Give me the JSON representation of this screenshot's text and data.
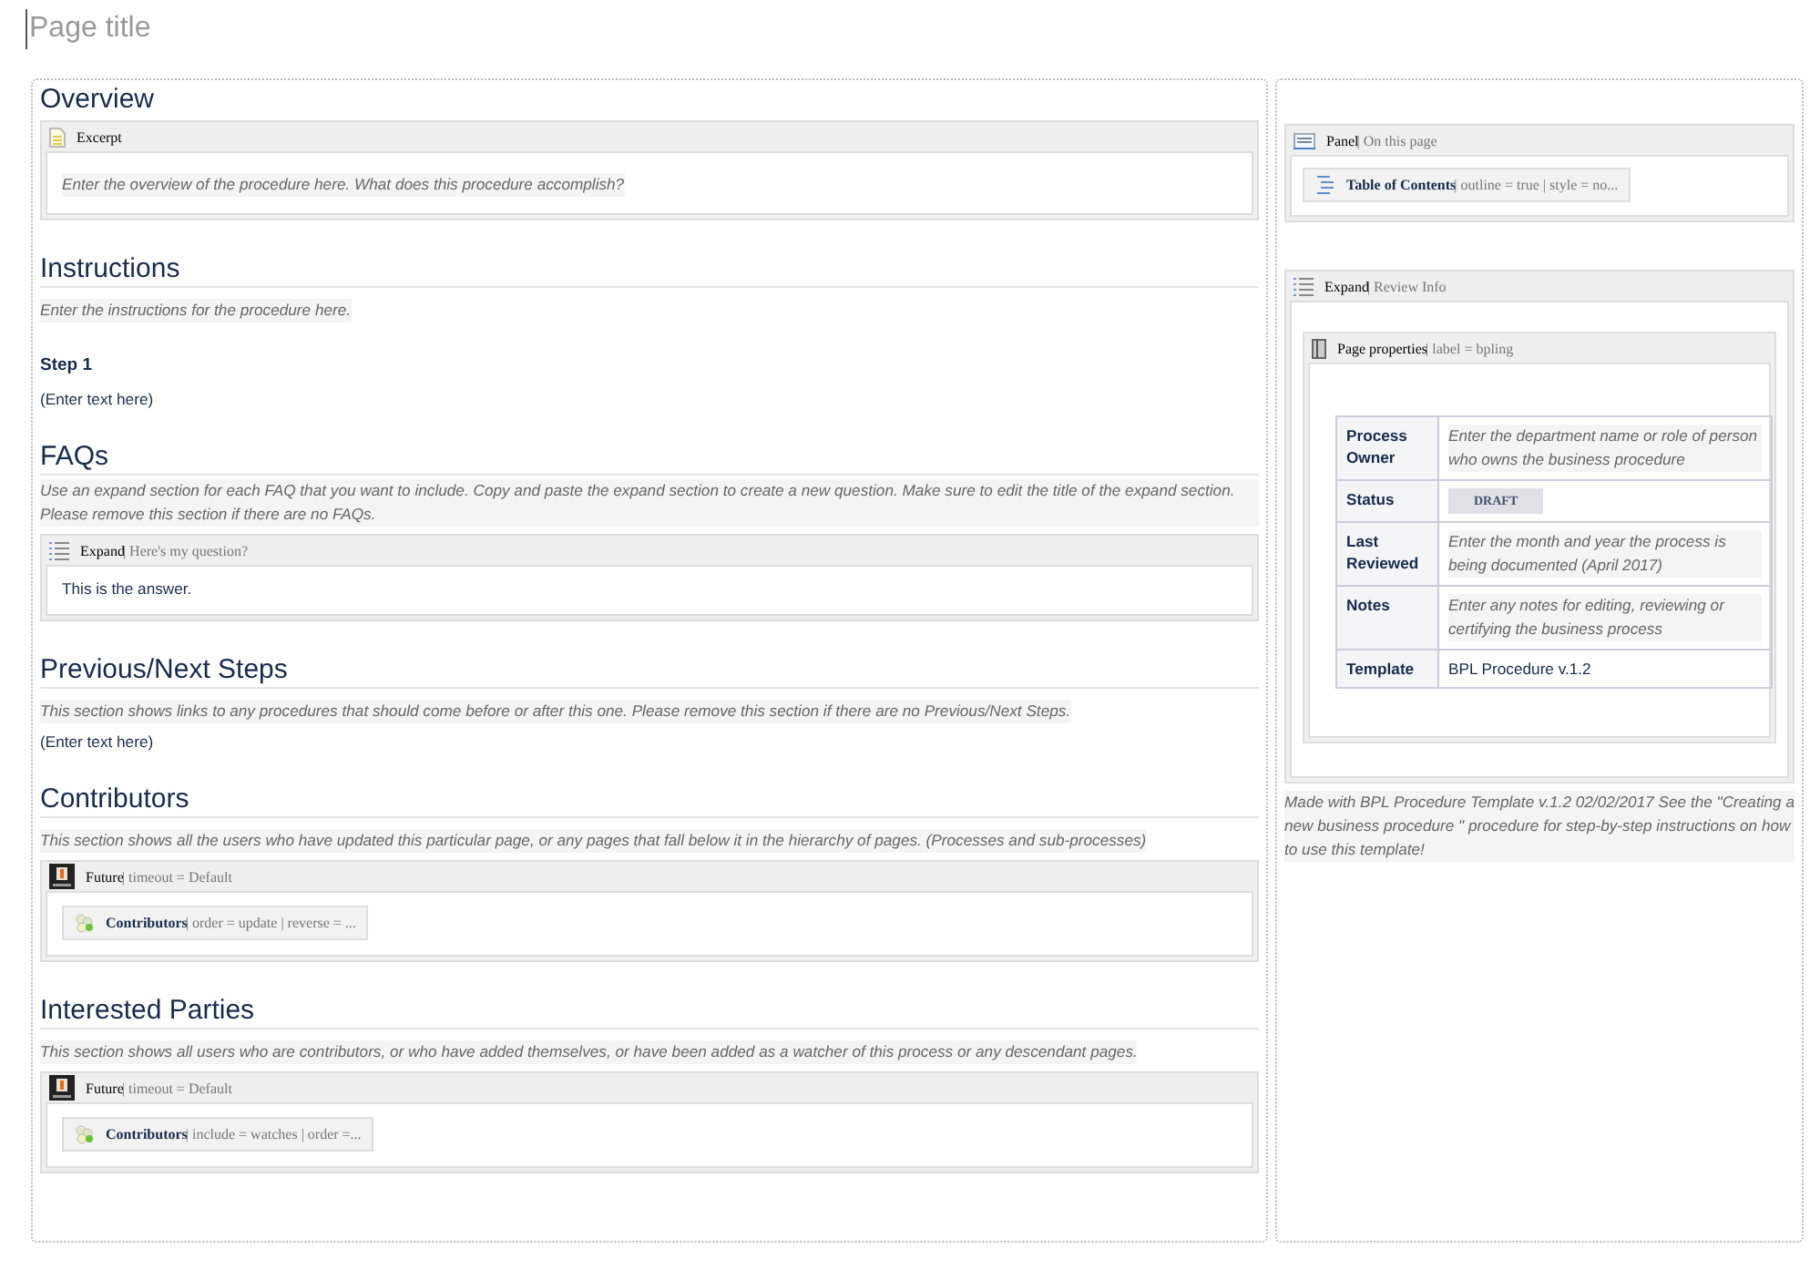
{
  "page_title": {
    "placeholder": "Page title"
  },
  "main": [
    {
      "kind": "heading",
      "text": "Overview"
    },
    {
      "kind": "excerpt",
      "name": "Excerpt",
      "body": [
        {
          "kind": "instruction",
          "text": "Enter the overview of the procedure here. What does this procedure accomplish?"
        }
      ]
    },
    {
      "kind": "heading",
      "text": "Instructions"
    },
    {
      "kind": "instruction",
      "text": "Enter the instructions for the procedure here."
    },
    {
      "kind": "subheading",
      "text": "Step 1"
    },
    {
      "kind": "paragraph",
      "text": "(Enter text here)"
    },
    {
      "kind": "heading",
      "text": "FAQs"
    },
    {
      "kind": "instruction",
      "text": "Use an expand section for each FAQ that you want to include. Copy and paste the expand section to create a new question. Make sure to edit the title of the expand section. Please remove this section if there are no FAQs."
    },
    {
      "kind": "expand",
      "name": "Expand",
      "params": "| Here's my question?",
      "body": [
        {
          "kind": "paragraph",
          "text": "This is the answer."
        }
      ]
    },
    {
      "kind": "heading",
      "text": "Previous/Next Steps"
    },
    {
      "kind": "instruction",
      "text": "This section shows links to any procedures that should come before or after this one. Please remove this section if there are no Previous/Next Steps."
    },
    {
      "kind": "paragraph",
      "text": "(Enter text here)"
    },
    {
      "kind": "heading",
      "text": "Contributors"
    },
    {
      "kind": "instruction",
      "text": "This section shows all the users who have updated this particular page, or any pages that fall below it in the hierarchy of pages. (Processes and sub-processes)"
    },
    {
      "kind": "future",
      "name": "Future",
      "params": "| timeout = Default",
      "body": [
        {
          "kind": "contributors",
          "name": "Contributors",
          "params": "| order = update | reverse = ..."
        }
      ]
    },
    {
      "kind": "heading",
      "text": "Interested Parties"
    },
    {
      "kind": "instruction",
      "text": "This section shows all users who are contributors, or who have added themselves, or have been added as a watcher of this process or any descendant pages."
    },
    {
      "kind": "future",
      "name": "Future",
      "params": "| timeout = Default",
      "body": [
        {
          "kind": "contributors",
          "name": "Contributors",
          "params": "| include = watches | order =..."
        }
      ]
    }
  ],
  "side": [
    {
      "kind": "panel",
      "name": "Panel",
      "params": "| On this page",
      "body": [
        {
          "kind": "toc",
          "name": "Table of Contents",
          "params": "| outline = true | style = no..."
        }
      ]
    },
    {
      "kind": "expand",
      "name": "Expand",
      "params": "| Review Info",
      "body": [
        {
          "kind": "page_properties",
          "name": "Page properties",
          "params": "| label = bpling",
          "body": [
            {
              "kind": "table",
              "rows": [
                {
                  "label": "Process Owner",
                  "kind": "instruction",
                  "value": "Enter the department name or role of person who owns the business procedure"
                },
                {
                  "label": "Status",
                  "kind": "status",
                  "value": "DRAFT"
                },
                {
                  "label": "Last Reviewed",
                  "kind": "instruction",
                  "value": "Enter the month and year the process is being documented (April 2017)"
                },
                {
                  "label": "Notes",
                  "kind": "instruction",
                  "value": "Enter any notes for editing, reviewing or certifying the business process"
                },
                {
                  "label": "Template",
                  "kind": "text",
                  "value": "BPL Procedure v.1.2"
                }
              ]
            }
          ]
        }
      ]
    },
    {
      "kind": "instruction",
      "text": "Made with BPL Procedure Template v.1.2 02/02/2017 See the \"Creating a new business procedure \" procedure for step-by-step instructions on how to use this template!"
    }
  ]
}
